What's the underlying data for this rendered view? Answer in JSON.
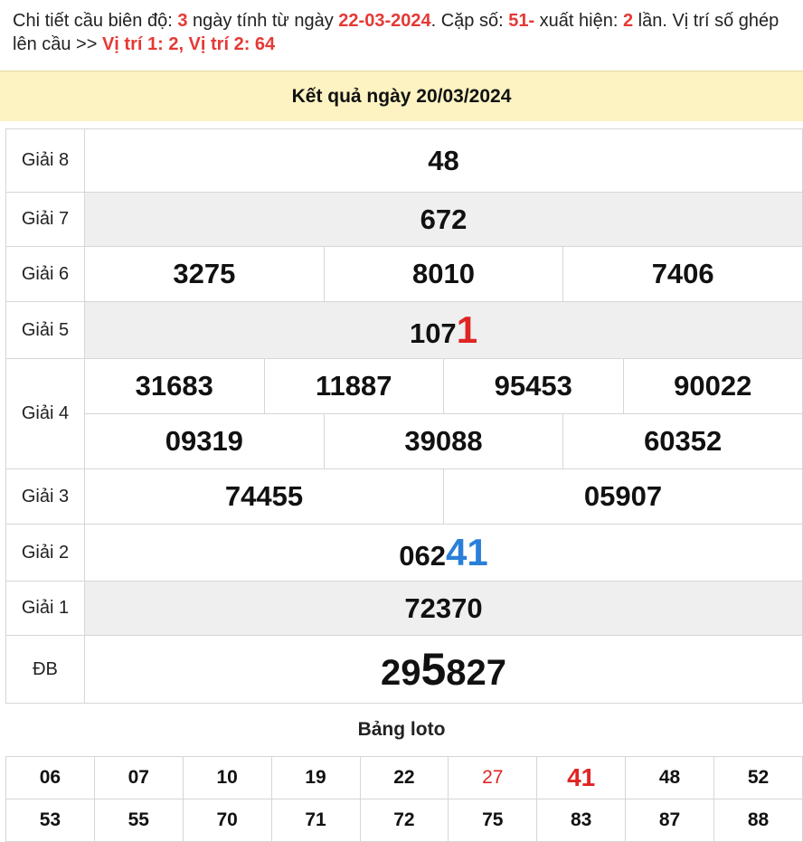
{
  "intro": {
    "t1": "Chi tiết cầu biên độ: ",
    "days": "3",
    "t2": " ngày tính từ ngày ",
    "date": "22-03-2024",
    "t3": ". Cặp số: ",
    "pair": "51-",
    "t4": " xuất hiện: ",
    "times": "2",
    "t5": " lần. Vị trí số ghép lên cầu >> ",
    "positions": "Vị trí 1: 2, Vị trí 2: 64"
  },
  "header": {
    "title": "Kết quả ngày 20/03/2024"
  },
  "results": {
    "g8": {
      "label": "Giải 8",
      "value": "48"
    },
    "g7": {
      "label": "Giải 7",
      "value": "672"
    },
    "g6": {
      "label": "Giải 6",
      "values": [
        "3275",
        "8010",
        "7406"
      ]
    },
    "g5": {
      "label": "Giải 5",
      "prefix": "107",
      "highlight": "1"
    },
    "g4": {
      "label": "Giải 4",
      "row1": [
        "31683",
        "11887",
        "95453",
        "90022"
      ],
      "row2": [
        "09319",
        "39088",
        "60352"
      ]
    },
    "g3": {
      "label": "Giải 3",
      "values": [
        "74455",
        "05907"
      ]
    },
    "g2": {
      "label": "Giải 2",
      "prefix": "062",
      "highlight": "41"
    },
    "g1": {
      "label": "Giải 1",
      "value": "72370"
    },
    "db": {
      "label": "ĐB",
      "prefix": "29",
      "highlight": "5",
      "suffix": "827"
    }
  },
  "loto": {
    "title": "Bảng loto",
    "row1": [
      "06",
      "07",
      "10",
      "19",
      "22",
      "27",
      "41",
      "48",
      "52"
    ],
    "row2": [
      "53",
      "55",
      "70",
      "71",
      "72",
      "75",
      "83",
      "87",
      "88"
    ]
  },
  "colors": {
    "red": "#e02424",
    "blue": "#2a7fd8",
    "header_bg": "#fdf3c2"
  }
}
